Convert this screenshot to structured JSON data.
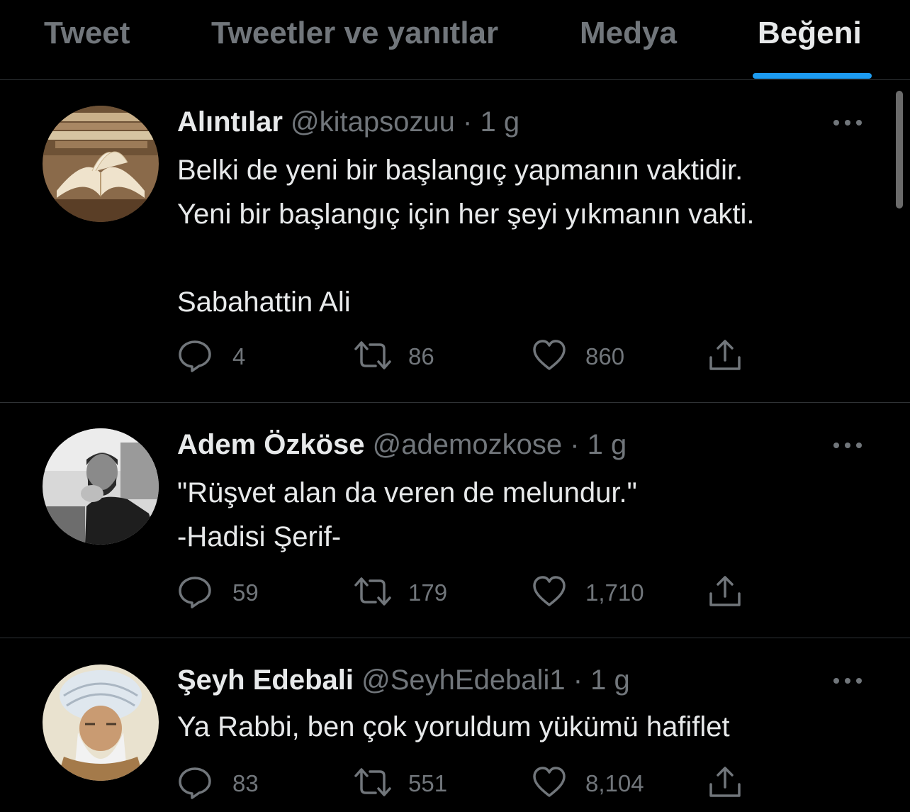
{
  "theme": {
    "background": "#000000",
    "text": "#e7e9ea",
    "secondary_text": "#71767b",
    "accent": "#1d9bf0",
    "divider": "#2f3336"
  },
  "tabs": [
    {
      "label": "Tweet",
      "active": false
    },
    {
      "label": "Tweetler ve yanıtlar",
      "active": false
    },
    {
      "label": "Medya",
      "active": false
    },
    {
      "label": "Beğeni",
      "active": true
    }
  ],
  "tweets": [
    {
      "name": "Alıntılar",
      "handle": "@kitapsozuu",
      "separator": "·",
      "time": "1 g",
      "text": "Belki de yeni bir başlangıç yapmanın vaktidir.\nYeni bir başlangıç için her şeyi yıkmanın vakti.\n\nSabahattin Ali",
      "replies": "4",
      "retweets": "86",
      "likes": "860",
      "avatar": "open-book-photo"
    },
    {
      "name": "Adem Özköse",
      "handle": "@ademozkose",
      "separator": "·",
      "time": "1 g",
      "text": "\"Rüşvet alan da veren de melundur.\"\n-Hadisi Şerif-",
      "replies": "59",
      "retweets": "179",
      "likes": "1,710",
      "avatar": "bw-portrait-photo"
    },
    {
      "name": "Şeyh Edebali",
      "handle": "@SeyhEdebali1",
      "separator": "·",
      "time": "1 g",
      "text": "Ya Rabbi, ben çok yoruldum yükümü hafiflet",
      "replies": "83",
      "retweets": "551",
      "likes": "8,104",
      "avatar": "turban-portrait-painting"
    }
  ],
  "icons": {
    "reply": "comment-bubble-icon",
    "retweet": "retweet-arrows-icon",
    "like": "heart-icon",
    "share": "share-upload-icon",
    "more": "more-dots-icon"
  }
}
